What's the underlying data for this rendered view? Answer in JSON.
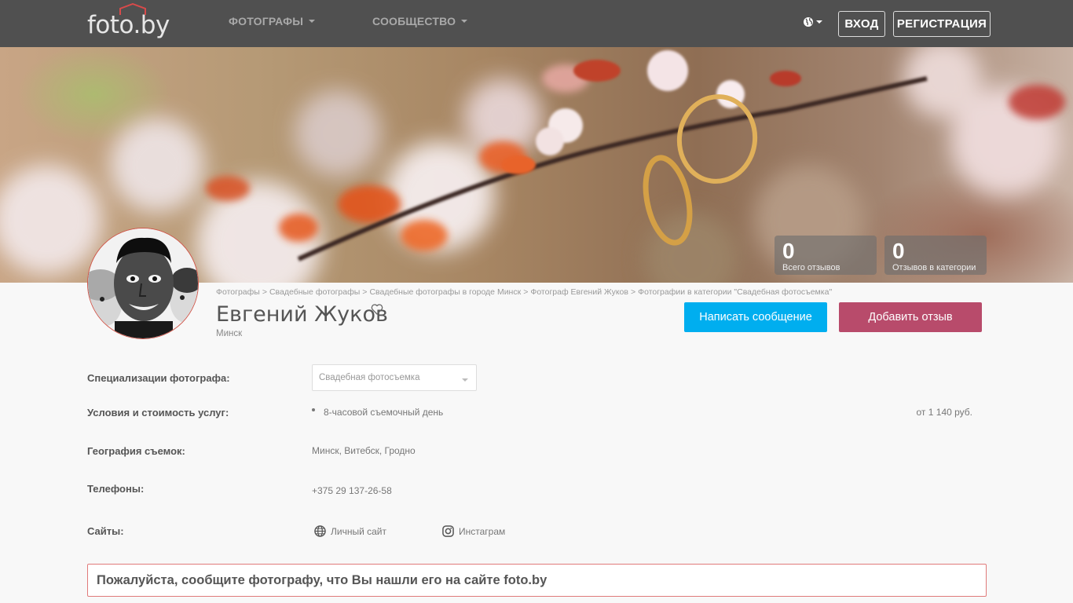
{
  "header": {
    "logo_text": "foto.by",
    "nav": [
      {
        "label": "ФОТОГРАФЫ"
      },
      {
        "label": "СООБЩЕСТВО"
      }
    ],
    "login_label": "ВХОД",
    "register_label": "РЕГИСТРАЦИЯ"
  },
  "banner": {
    "stats": [
      {
        "value": "0",
        "label": "Всего отзывов"
      },
      {
        "value": "0",
        "label": "Отзывов в категории"
      }
    ]
  },
  "breadcrumb": [
    "Фотографы",
    "Свадебные фотографы",
    "Свадебные фотографы в городе Минск",
    "Фотограф Евгений Жуков",
    "Фотографии в категории \"Свадебная фотосъемка\""
  ],
  "breadcrumb_separator": ">",
  "profile": {
    "name": "Евгений Жуков",
    "city": "Минск",
    "write_message_label": "Написать сообщение",
    "add_review_label": "Добавить отзыв"
  },
  "details": {
    "specializations_label": "Специализации фотографа:",
    "specialization_selected": "Свадебная фотосъемка",
    "conditions_label": "Условия и стоимость услуг:",
    "service_name": "8-часовой съемочный день",
    "service_price": "от 1 140 руб.",
    "geography_label": "География съемок:",
    "geography_value": "Минск, Витебск, Гродно",
    "phones_label": "Телефоны:",
    "phone_value": "+375 29 137-26-58",
    "sites_label": "Сайты:",
    "personal_site_label": "Личный сайт",
    "instagram_label": "Инстаграм"
  },
  "notice": "Пожалуйста, сообщите фотографу, что Вы нашли его на сайте foto.by",
  "colors": {
    "header_bg": "#505050",
    "message_button": "#00aeef",
    "review_button": "#b84b6b",
    "notice_border": "#e07a7a"
  }
}
